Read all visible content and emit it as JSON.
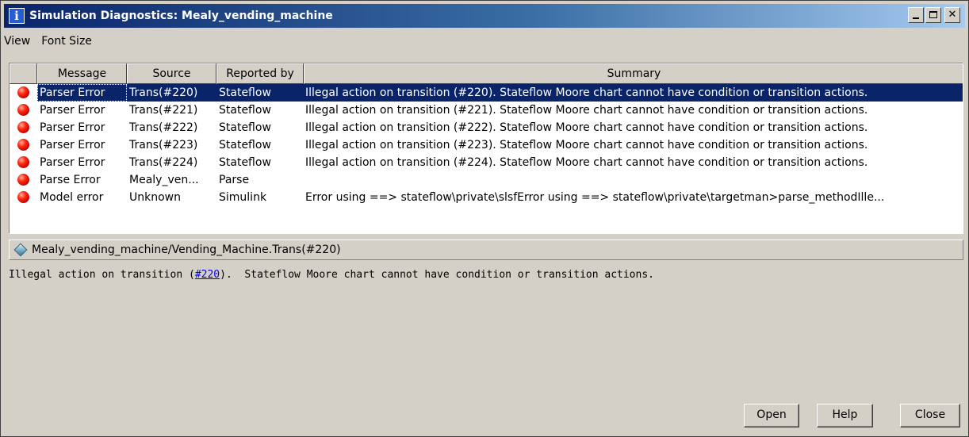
{
  "window": {
    "title": "Simulation Diagnostics: Mealy_vending_machine",
    "title_icon": "i"
  },
  "menu": [
    "View",
    "Font Size"
  ],
  "table": {
    "columns": [
      "Message",
      "Source",
      "Reported by",
      "Summary"
    ],
    "rows": [
      {
        "message": "Parser Error",
        "source": "Trans(#220)",
        "reported_by": "Stateflow",
        "summary": "Illegal action on transition (#220).  Stateflow Moore chart cannot have condition or transition actions."
      },
      {
        "message": "Parser Error",
        "source": "Trans(#221)",
        "reported_by": "Stateflow",
        "summary": "Illegal action on transition (#221).  Stateflow Moore chart cannot have condition or transition actions."
      },
      {
        "message": "Parser Error",
        "source": "Trans(#222)",
        "reported_by": "Stateflow",
        "summary": "Illegal action on transition (#222).  Stateflow Moore chart cannot have condition or transition actions."
      },
      {
        "message": "Parser Error",
        "source": "Trans(#223)",
        "reported_by": "Stateflow",
        "summary": "Illegal action on transition (#223).  Stateflow Moore chart cannot have condition or transition actions."
      },
      {
        "message": "Parser Error",
        "source": "Trans(#224)",
        "reported_by": "Stateflow",
        "summary": "Illegal action on transition (#224).  Stateflow Moore chart cannot have condition or transition actions."
      },
      {
        "message": "Parse Error",
        "source": "Mealy_ven...",
        "reported_by": "Parse",
        "summary": ""
      },
      {
        "message": "Model error",
        "source": "Unknown",
        "reported_by": "Simulink",
        "summary": "Error using ==> stateflow\\private\\slsfError using ==> stateflow\\private\\targetman>parse_methodIlle..."
      }
    ],
    "selected_row": 0
  },
  "path": "Mealy_vending_machine/Vending_Machine.Trans(#220)",
  "detail": {
    "prefix": "Illegal action on transition (",
    "link": "#220",
    "suffix": ").  Stateflow Moore chart cannot have condition or transition actions."
  },
  "buttons": {
    "open": "Open",
    "help": "Help",
    "close": "Close"
  },
  "colors": {
    "selection": "#0a246a",
    "titlebar": "#0a246a",
    "error_icon": "#e00000",
    "background": "#d4d0c8"
  }
}
